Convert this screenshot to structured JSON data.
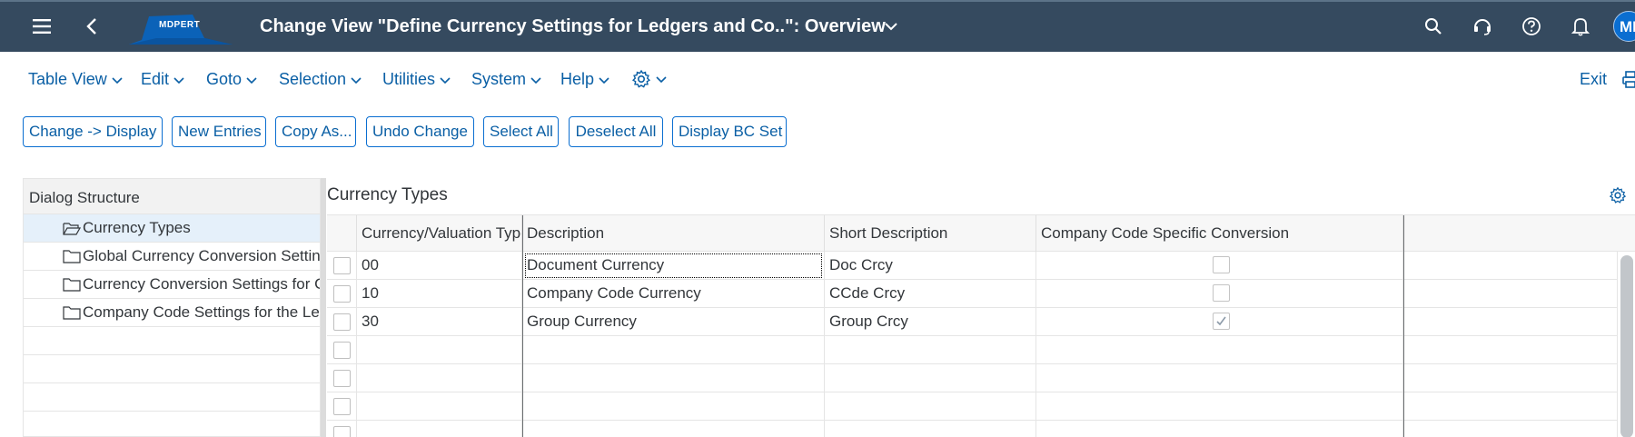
{
  "shell": {
    "title": "Change View \"Define Currency Settings for Ledgers and Co..\": Overview",
    "logo_text": "MDPERT",
    "avatar_initials": "MD",
    "icons": [
      "menu-icon",
      "back-icon",
      "search-icon",
      "headset-icon",
      "help-icon",
      "bell-icon"
    ]
  },
  "menu": {
    "items": [
      "Table View",
      "Edit",
      "Goto",
      "Selection",
      "Utilities",
      "System",
      "Help"
    ],
    "exit_label": "Exit"
  },
  "toolbar": {
    "buttons": [
      "Change -> Display",
      "New Entries",
      "Copy As...",
      "Undo Change",
      "Select All",
      "Deselect All",
      "Display BC Set"
    ]
  },
  "dialog": {
    "header": "Dialog Structure",
    "items": [
      {
        "label": "Currency Types",
        "selected": true
      },
      {
        "label": "Global Currency Conversion Settings",
        "selected": false
      },
      {
        "label": "Currency Conversion Settings for Company Code",
        "selected": false
      },
      {
        "label": "Company Code Settings for the Ledger",
        "selected": false
      }
    ]
  },
  "panel": {
    "title": "Currency Types",
    "columns": [
      "Currency/Valuation Type",
      "Description",
      "Short Description",
      "Company Code Specific Conversion"
    ],
    "rows": [
      {
        "code": "00",
        "description": "Document Currency",
        "short": "Doc Crcy",
        "company_specific": false
      },
      {
        "code": "10",
        "description": "Company Code Currency",
        "short": "CCde Crcy",
        "company_specific": false
      },
      {
        "code": "30",
        "description": "Group Currency",
        "short": "Group Crcy",
        "company_specific": true
      }
    ]
  },
  "colors": {
    "shell_bg": "#354a5f",
    "link": "#0a5fa5",
    "accent": "#0a6ed1",
    "selection_bg": "#e5f0fa"
  }
}
